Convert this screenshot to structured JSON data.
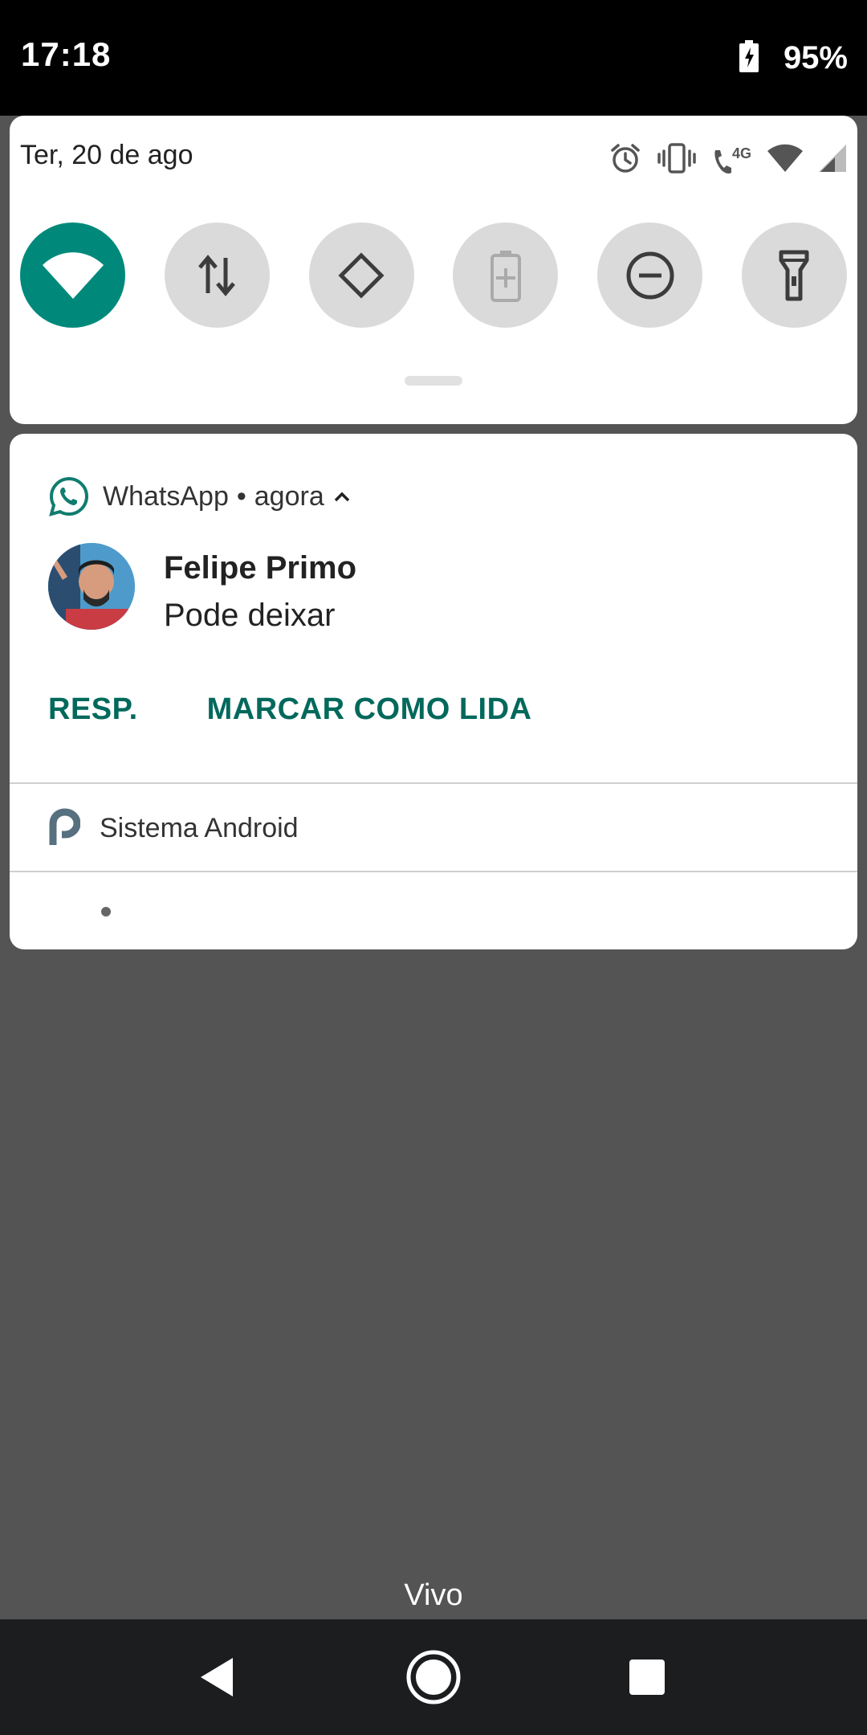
{
  "status_bar": {
    "time": "17:18",
    "battery_percent": "95%"
  },
  "quick_settings": {
    "date": "Ter, 20 de ago",
    "status_icons": [
      "alarm-icon",
      "vibrate-icon",
      "volte-4g-icon",
      "wifi-icon",
      "signal-icon"
    ],
    "network_label": "4G",
    "tiles": [
      {
        "name": "wifi",
        "active": true
      },
      {
        "name": "mobile-data",
        "active": false
      },
      {
        "name": "auto-rotate",
        "active": false
      },
      {
        "name": "battery-saver",
        "active": false
      },
      {
        "name": "do-not-disturb",
        "active": false
      },
      {
        "name": "flashlight",
        "active": false
      }
    ],
    "colors": {
      "tile_active": "#00897b",
      "tile_inactive": "#dadada"
    }
  },
  "notifications": {
    "whatsapp": {
      "app_name": "WhatsApp",
      "separator": "•",
      "time": "agora",
      "sender": "Felipe Primo",
      "message": "Pode deixar",
      "actions": {
        "reply": "RESP.",
        "mark_read": "MARCAR COMO LIDA"
      },
      "accent": "#00695c"
    },
    "system": {
      "app_name": "Sistema Android"
    }
  },
  "carrier": "Vivo"
}
